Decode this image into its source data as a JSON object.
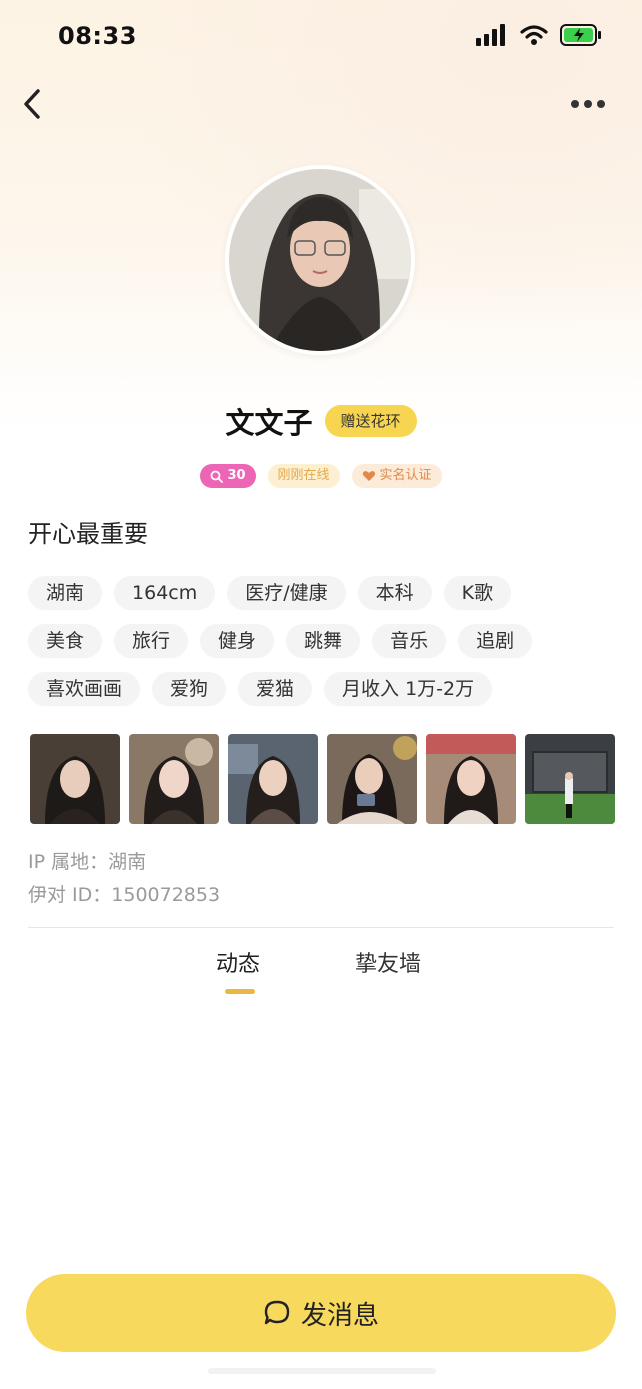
{
  "status_bar": {
    "time": "08:33"
  },
  "profile": {
    "name": "文文子",
    "gift_button": "赠送花环",
    "badges": {
      "score": "30",
      "online": "刚刚在线",
      "verified": "实名认证"
    },
    "signature": "开心最重要",
    "tags": [
      [
        "湖南",
        "164cm",
        "医疗/健康",
        "本科",
        "K歌"
      ],
      [
        "美食",
        "旅行",
        "健身",
        "跳舞",
        "音乐",
        "追剧"
      ],
      [
        "喜欢画画",
        "爱狗",
        "爱猫",
        "月收入 1万-2万"
      ]
    ],
    "ip_location": "IP 属地：湖南",
    "user_id": "伊对 ID：150072853"
  },
  "tabs": [
    {
      "label": "动态",
      "active": true
    },
    {
      "label": "挚友墙",
      "active": false
    }
  ],
  "send_message": {
    "label": "发消息"
  },
  "colors": {
    "accent": "#f7d95d",
    "pink_badge": "#ec66b5",
    "tab_indicator": "#e9b83e"
  },
  "icons": [
    "back-arrow-icon",
    "more-dots-icon",
    "signal-icon",
    "wifi-icon",
    "battery-charging-icon",
    "search-icon",
    "heart-badge-icon",
    "chat-bubble-icon"
  ]
}
